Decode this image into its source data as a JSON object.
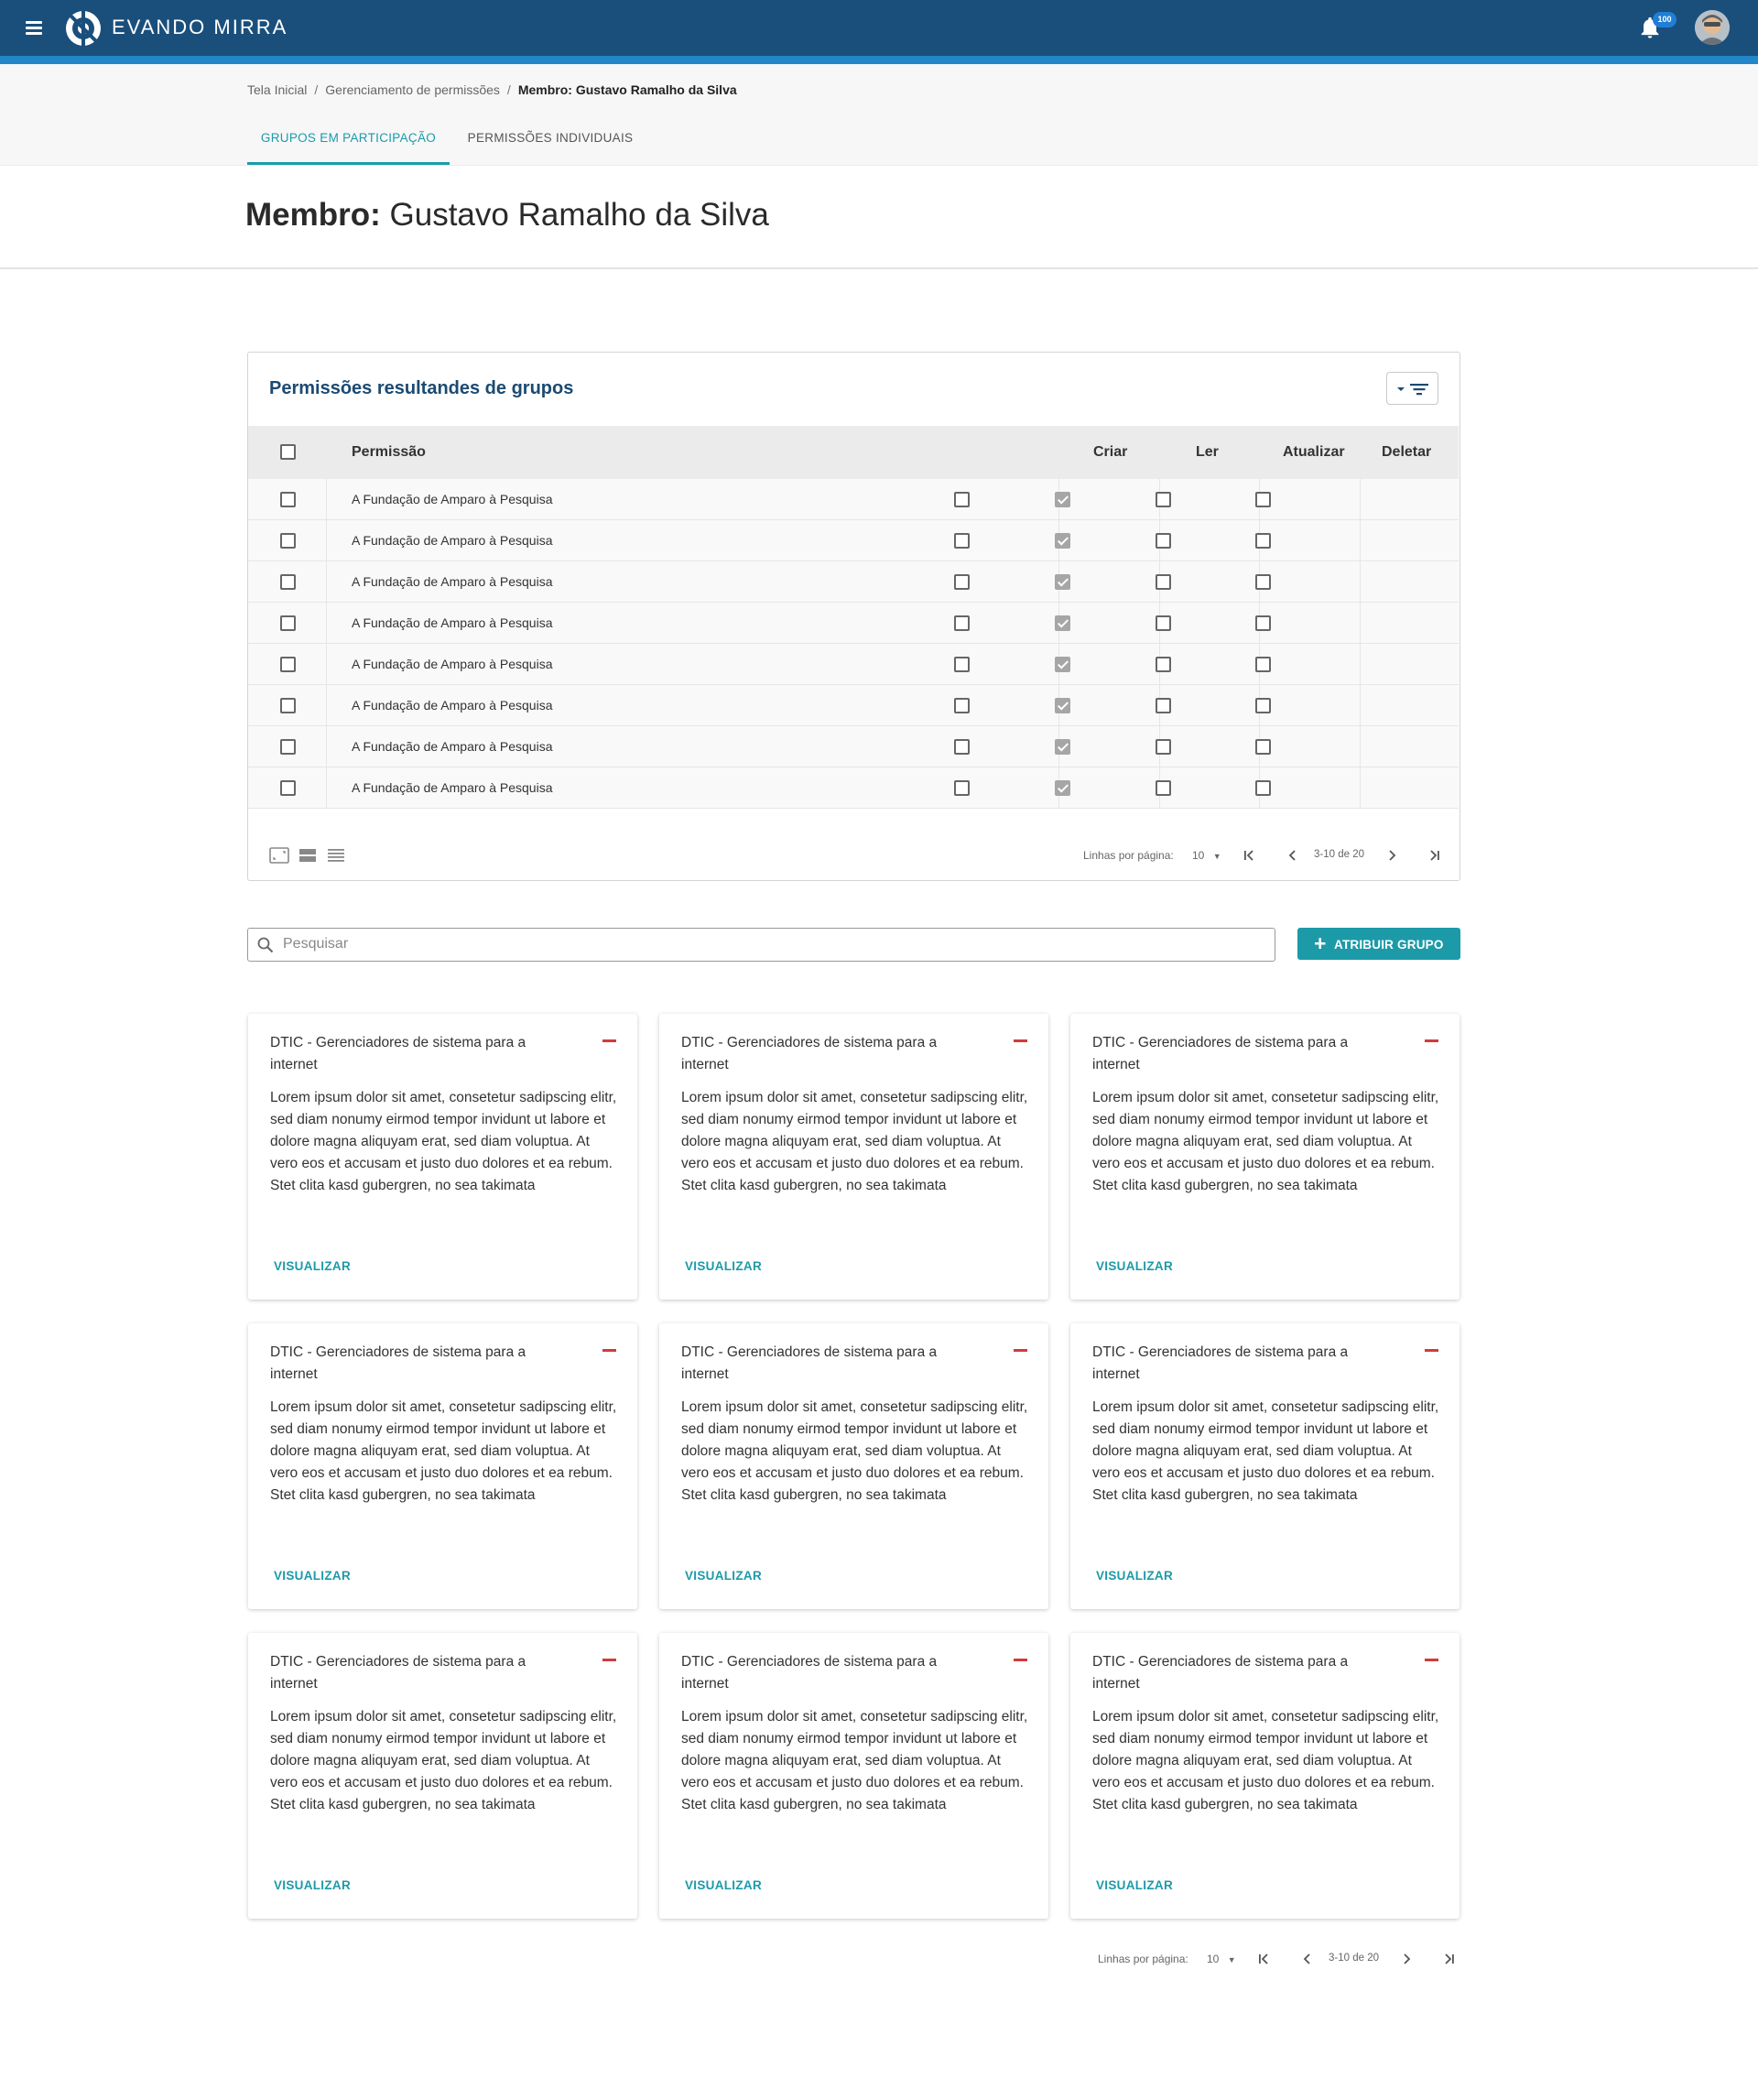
{
  "app": {
    "brand": "EVANDO MIRRA",
    "notifications_count": "100"
  },
  "breadcrumb": {
    "home": "Tela Inicial",
    "section": "Gerenciamento de permissões",
    "current": "Membro: Gustavo Ramalho da Silva"
  },
  "tabs": [
    {
      "label": "GRUPOS EM PARTICIPAÇÃO",
      "active": true
    },
    {
      "label": "PERMISSÕES INDIVIDUAIS",
      "active": false
    }
  ],
  "page": {
    "title_prefix": "Membro:",
    "title_name": "Gustavo Ramalho da Silva"
  },
  "permissions_table": {
    "title": "Permissões resultandes de grupos",
    "columns": {
      "permission": "Permissão",
      "create": "Criar",
      "read": "Ler",
      "update": "Atualizar",
      "delete": "Deletar"
    },
    "rows": [
      {
        "name": "A Fundação de Amparo à Pesquisa",
        "selected": false,
        "create": false,
        "read": true,
        "update": false,
        "delete": false
      },
      {
        "name": "A Fundação de Amparo à Pesquisa",
        "selected": false,
        "create": false,
        "read": true,
        "update": false,
        "delete": false
      },
      {
        "name": "A Fundação de Amparo à Pesquisa",
        "selected": false,
        "create": false,
        "read": true,
        "update": false,
        "delete": false
      },
      {
        "name": "A Fundação de Amparo à Pesquisa",
        "selected": false,
        "create": false,
        "read": true,
        "update": false,
        "delete": false
      },
      {
        "name": "A Fundação de Amparo à Pesquisa",
        "selected": false,
        "create": false,
        "read": true,
        "update": false,
        "delete": false
      },
      {
        "name": "A Fundação de Amparo à Pesquisa",
        "selected": false,
        "create": false,
        "read": true,
        "update": false,
        "delete": false
      },
      {
        "name": "A Fundação de Amparo à Pesquisa",
        "selected": false,
        "create": false,
        "read": true,
        "update": false,
        "delete": false
      },
      {
        "name": "A Fundação de Amparo à Pesquisa",
        "selected": false,
        "create": false,
        "read": true,
        "update": false,
        "delete": false
      }
    ],
    "pagination": {
      "rows_per_page_label": "Linhas por página:",
      "rows_per_page": "10",
      "range": "3-10 de 20"
    },
    "density_icons": [
      "fullscreen-icon",
      "comfortable-density-icon",
      "compact-density-icon"
    ]
  },
  "search": {
    "placeholder": "Pesquisar",
    "value": ""
  },
  "assign_button": {
    "label": "ATRIBUIR GRUPO"
  },
  "cards": [
    {
      "title": "DTIC - Gerenciadores de sistema para a internet",
      "body": "Lorem ipsum dolor sit amet, consetetur sadipscing elitr, sed diam nonumy eirmod tempor invidunt ut labore et dolore magna aliquyam erat, sed diam voluptua. At vero eos et accusam et justo duo dolores et ea rebum. Stet clita kasd gubergren, no sea takimata",
      "action": "VISUALIZAR"
    },
    {
      "title": "DTIC - Gerenciadores de sistema para a internet",
      "body": "Lorem ipsum dolor sit amet, consetetur sadipscing elitr, sed diam nonumy eirmod tempor invidunt ut labore et dolore magna aliquyam erat, sed diam voluptua. At vero eos et accusam et justo duo dolores et ea rebum. Stet clita kasd gubergren, no sea takimata",
      "action": "VISUALIZAR"
    },
    {
      "title": "DTIC - Gerenciadores de sistema para a internet",
      "body": "Lorem ipsum dolor sit amet, consetetur sadipscing elitr, sed diam nonumy eirmod tempor invidunt ut labore et dolore magna aliquyam erat, sed diam voluptua. At vero eos et accusam et justo duo dolores et ea rebum. Stet clita kasd gubergren, no sea takimata",
      "action": "VISUALIZAR"
    },
    {
      "title": "DTIC - Gerenciadores de sistema para a internet",
      "body": "Lorem ipsum dolor sit amet, consetetur sadipscing elitr, sed diam nonumy eirmod tempor invidunt ut labore et dolore magna aliquyam erat, sed diam voluptua. At vero eos et accusam et justo duo dolores et ea rebum. Stet clita kasd gubergren, no sea takimata",
      "action": "VISUALIZAR"
    },
    {
      "title": "DTIC - Gerenciadores de sistema para a internet",
      "body": "Lorem ipsum dolor sit amet, consetetur sadipscing elitr, sed diam nonumy eirmod tempor invidunt ut labore et dolore magna aliquyam erat, sed diam voluptua. At vero eos et accusam et justo duo dolores et ea rebum. Stet clita kasd gubergren, no sea takimata",
      "action": "VISUALIZAR"
    },
    {
      "title": "DTIC - Gerenciadores de sistema para a internet",
      "body": "Lorem ipsum dolor sit amet, consetetur sadipscing elitr, sed diam nonumy eirmod tempor invidunt ut labore et dolore magna aliquyam erat, sed diam voluptua. At vero eos et accusam et justo duo dolores et ea rebum. Stet clita kasd gubergren, no sea takimata",
      "action": "VISUALIZAR"
    },
    {
      "title": "DTIC - Gerenciadores de sistema para a internet",
      "body": "Lorem ipsum dolor sit amet, consetetur sadipscing elitr, sed diam nonumy eirmod tempor invidunt ut labore et dolore magna aliquyam erat, sed diam voluptua. At vero eos et accusam et justo duo dolores et ea rebum. Stet clita kasd gubergren, no sea takimata",
      "action": "VISUALIZAR"
    },
    {
      "title": "DTIC - Gerenciadores de sistema para a internet",
      "body": "Lorem ipsum dolor sit amet, consetetur sadipscing elitr, sed diam nonumy eirmod tempor invidunt ut labore et dolore magna aliquyam erat, sed diam voluptua. At vero eos et accusam et justo duo dolores et ea rebum. Stet clita kasd gubergren, no sea takimata",
      "action": "VISUALIZAR"
    },
    {
      "title": "DTIC - Gerenciadores de sistema para a internet",
      "body": "Lorem ipsum dolor sit amet, consetetur sadipscing elitr, sed diam nonumy eirmod tempor invidunt ut labore et dolore magna aliquyam erat, sed diam voluptua. At vero eos et accusam et justo duo dolores et ea rebum. Stet clita kasd gubergren, no sea takimata",
      "action": "VISUALIZAR"
    }
  ],
  "cards_pagination": {
    "rows_per_page_label": "Linhas por página:",
    "rows_per_page": "10",
    "range": "3-10 de 20"
  },
  "colors": {
    "header": "#1a4f7c",
    "header_stripe": "#2286c8",
    "accent": "#1c9aa8",
    "title_blue": "#1b4a72",
    "remove_red": "#d23b3b"
  }
}
